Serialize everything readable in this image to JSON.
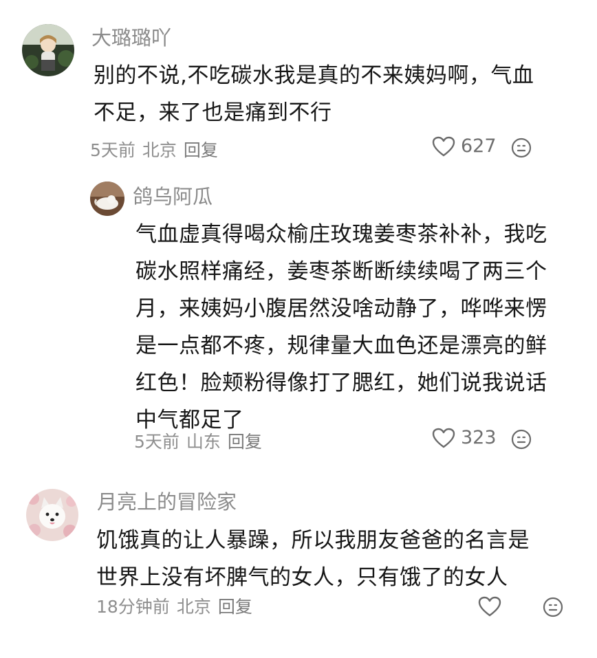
{
  "comments": [
    {
      "username": "大璐璐吖",
      "text_lines": [
        "别的不说,不吃碳水我是真的不来姨妈啊，气血",
        "不足，来了也是痛到不行"
      ],
      "time": "5天前",
      "location": "北京",
      "reply_label": "回复",
      "likes": "627",
      "like_icon": "heart-outline",
      "emoji_icon": "smiley-face"
    },
    {
      "username": "鸽乌阿瓜",
      "text_lines": [
        "气血虚真得喝众榆庄玫瑰姜枣茶补补，我吃",
        "碳水照样痛经，姜枣茶断断续续喝了两三个",
        "月，来姨妈小腹居然没啥动静了，哗哗来愣",
        "是一点都不疼，规律量大血色还是漂亮的鲜",
        "红色！脸颊粉得像打了腮红，她们说我说话",
        "中气都足了"
      ],
      "time": "5天前",
      "location": "山东",
      "reply_label": "回复",
      "likes": "323",
      "like_icon": "heart-outline",
      "emoji_icon": "smiley-face"
    },
    {
      "username": "月亮上的冒险家",
      "text_lines": [
        "饥饿真的让人暴躁，所以我朋友爸爸的名言是",
        "世界上没有坏脾气的女人，只有饿了的女人"
      ],
      "time": "18分钟前",
      "location": "北京",
      "reply_label": "回复",
      "likes": "",
      "like_icon": "heart-outline",
      "emoji_icon": "smiley-face"
    }
  ]
}
